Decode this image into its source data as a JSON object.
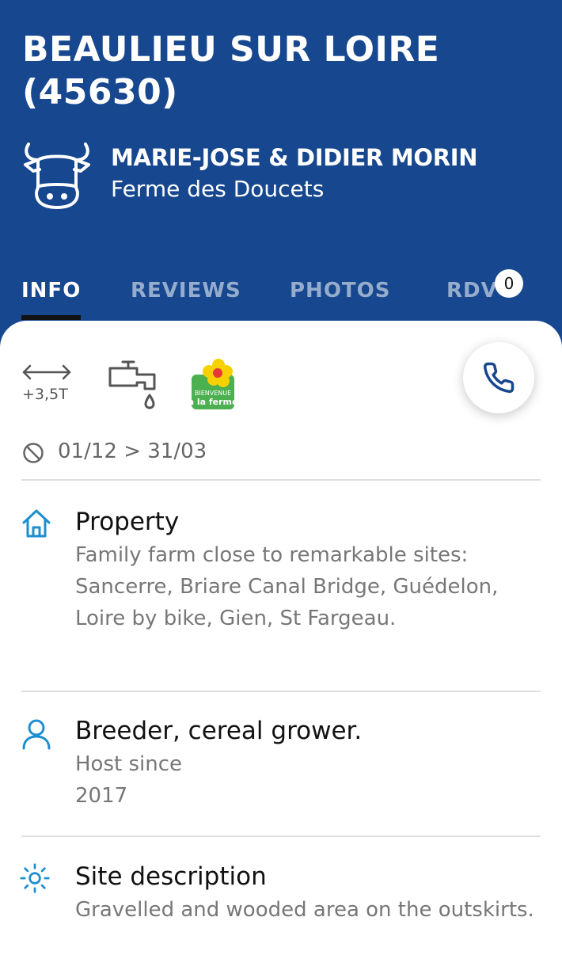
{
  "header": {
    "title": "BEAULIEU SUR LOIRE (45630)",
    "host_icon": "cow-icon",
    "host_name": "MARIE-JOSE & DIDIER MORIN",
    "farm_name": "Ferme des Doucets"
  },
  "tabs": [
    {
      "label": "INFO",
      "active": true
    },
    {
      "label": "REVIEWS",
      "active": false
    },
    {
      "label": "PHOTOS",
      "active": false
    },
    {
      "label": "RDV",
      "active": false,
      "badge": "0"
    }
  ],
  "amenities": {
    "size_limit": "+3,5T",
    "icons": [
      "width-arrows-icon",
      "water-tap-icon",
      "bienvenue-a-la-ferme-logo"
    ],
    "logo_text": [
      "BIENVENUE",
      "à la ferme"
    ]
  },
  "closed_period": "01/12 > 31/03",
  "sections": [
    {
      "icon": "house-icon",
      "title": "Property",
      "body": "Family farm close to remarkable sites: Sancerre, Briare Canal Bridge, Guédelon, Loire by bike, Gien, St Fargeau."
    },
    {
      "icon": "person-icon",
      "title": "Breeder, cereal grower.",
      "body_lines": [
        "Host since",
        "2017"
      ]
    },
    {
      "icon": "sun-icon",
      "title": "Site description",
      "body": "Gravelled and wooded area on the outskirts."
    }
  ],
  "colors": {
    "header_bg": "#16478f",
    "accent_icon": "#1d8fd0",
    "call_icon": "#16478f"
  }
}
